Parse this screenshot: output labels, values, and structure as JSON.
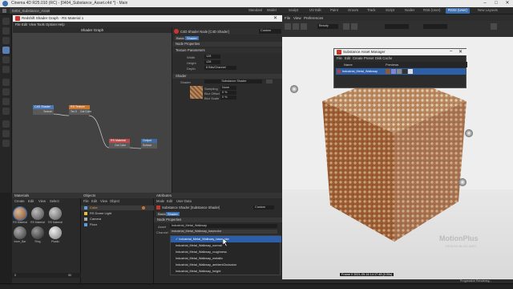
{
  "window": {
    "title": "Cinema 4D R25.010 (RC) - [0404_Substance_Asset.c4d *] - Main",
    "controls": [
      "–",
      "□",
      "✕"
    ]
  },
  "tabs": {
    "doc_tabs": [
      "0404_Substance_Asset..."
    ],
    "layouts": [
      "Standard",
      "Model",
      "Sculpt",
      "UV Edit",
      "Paint",
      "Groom",
      "Track",
      "Script",
      "Nodes",
      "RS6 (User)",
      "RS32 (User)"
    ],
    "new_layouts": "New Layouts"
  },
  "shader_graph": {
    "title": "Redshift Shader Graph - RS Material 1",
    "menu": [
      "File",
      "Edit",
      "View",
      "Tools",
      "Options",
      "Help"
    ],
    "graph_title": "Shader Graph",
    "nodes": {
      "c4d_shader": {
        "name": "C4D Shader",
        "port": "Texture"
      },
      "rs_texture": {
        "name": "RS Texture",
        "ports": [
          "Tex 0",
          "Out Color"
        ]
      },
      "rs_material": {
        "name": "RS Material",
        "port": "Out Color"
      },
      "output": {
        "name": "Output",
        "port": "Surface"
      }
    },
    "attr": {
      "header": "C4D Shader Node [C4D Shader]",
      "mode": "Custom",
      "tabs": [
        "Basic",
        "Shader"
      ],
      "node_properties": "Node Properties",
      "texture_params": "Texture Parameters",
      "width_label": "Width",
      "width_val": "128",
      "height_label": "Height",
      "height_val": "128",
      "depth_label": "Depth",
      "depth_val": "8 Bits/Channel",
      "shader_section": "Shader",
      "shader_label": "Shader",
      "shader_val": "Substance Shader",
      "sampling_label": "Sampling",
      "sampling_val": "None",
      "bluroffset_label": "Blur Offset",
      "bluroffset_val": "0 %",
      "blurscale_label": "Blur Scale",
      "blurscale_val": "0 %"
    }
  },
  "viewport": {
    "menu": [
      "File",
      "View",
      "Preferences"
    ],
    "camera_dropdown": "Beauty",
    "status": "Progressive Rendering...",
    "frame_info": "Frame 0  2021-09-16  14:17:48  (0.00s)",
    "watermark_line1": "MotionPlus",
    "watermark_line2": "DESIGN.BLOG.INFO"
  },
  "substance_manager": {
    "title": "Substance Asset Manager",
    "menu": [
      "File",
      "Edit",
      "Create",
      "Preset",
      "Disk Cache"
    ],
    "col_name": "Name",
    "col_preview": "Previews",
    "asset": "Industrial_Metal_Walkway"
  },
  "materials_pane": {
    "title": "Materials",
    "menu": [
      "Create",
      "Edit",
      "View",
      "Select"
    ],
    "items": [
      {
        "label": "RS Material"
      },
      {
        "label": "RS Material"
      },
      {
        "label": "RS Material"
      },
      {
        "label": "Inner_Bar"
      },
      {
        "label": "Ring"
      },
      {
        "label": "Plastic"
      }
    ]
  },
  "objects_pane": {
    "title": "Objects",
    "menu": [
      "File",
      "Edit",
      "View",
      "Object"
    ],
    "items": [
      "Cube",
      "RS Dome Light",
      "Camera",
      "Floor"
    ]
  },
  "attributes_pane": {
    "title": "Attributes",
    "menu": [
      "Mode",
      "Edit",
      "User Data"
    ],
    "header": "Substance Shader [Substance Shader]",
    "mode": "Custom",
    "tabs": [
      "Basic",
      "Shader"
    ],
    "node_properties": "Node Properties",
    "asset_label": "Asset",
    "asset_val": "Industrial_Metal_Walkway",
    "channel_label": "Channel",
    "channel_val": "Industrial_Metal_Walkway_basecolor",
    "dropdown": [
      "Industrial_Metal_Walkway_basecolor",
      "Industrial_Metal_Walkway_normal",
      "Industrial_Metal_Walkway_roughness",
      "Industrial_Metal_Walkway_metallic",
      "Industrial_Metal_Walkway_ambientOcclusion",
      "Industrial_Metal_Walkway_height"
    ]
  },
  "timeline": {
    "start": "0",
    "end": "90"
  },
  "colors": {
    "accent": "#3b6fb0",
    "dropdown_selected": "#2d5ea8",
    "node_orange": "#c9762f",
    "node_blue": "#4a78b8",
    "node_red": "#b84a4a",
    "rust": "#9a5a32"
  }
}
